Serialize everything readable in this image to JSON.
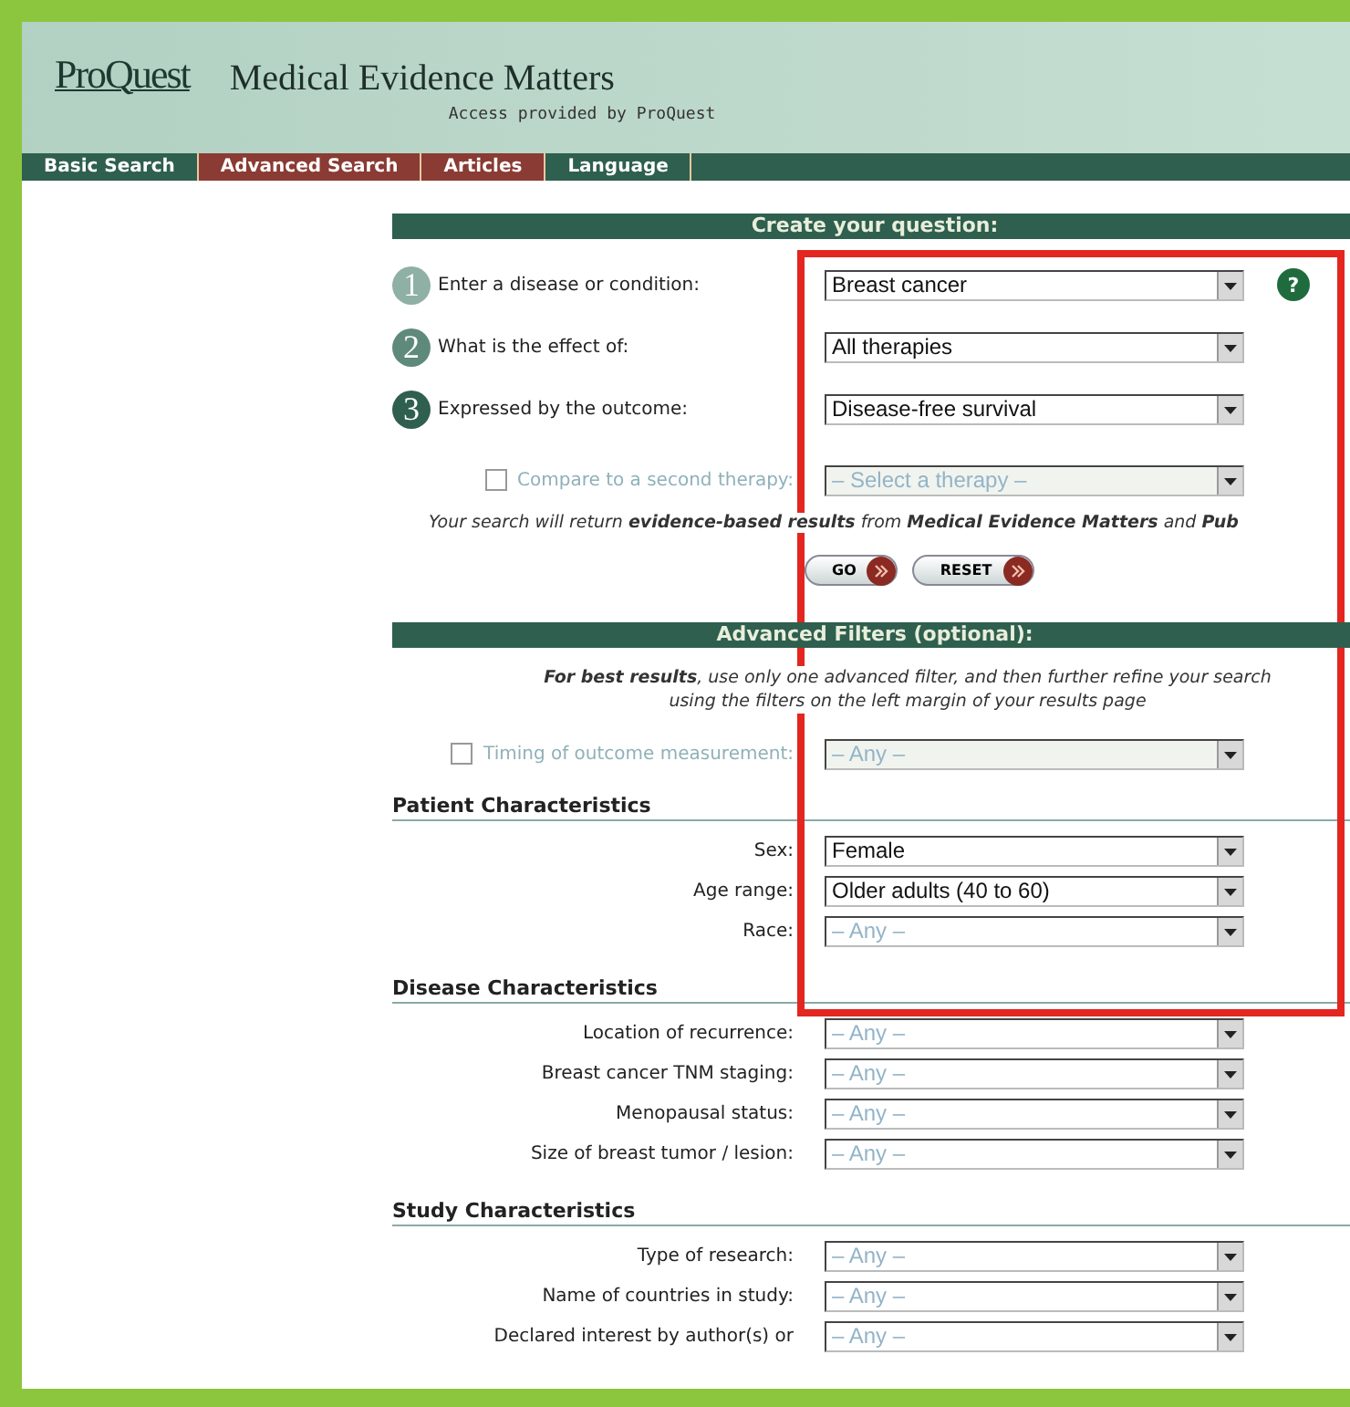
{
  "header": {
    "logo": "ProQuest",
    "title": "Medical Evidence Matters",
    "subtitle": "Access provided by ProQuest"
  },
  "nav": [
    {
      "label": "Basic Search",
      "color": "#2f5f4e"
    },
    {
      "label": "Advanced Search",
      "color": "#8a3b33"
    },
    {
      "label": "Articles",
      "color": "#8a3b33"
    },
    {
      "label": "Language",
      "color": "#2f5f4e"
    }
  ],
  "question": {
    "title": "Create your question:",
    "steps": [
      {
        "number": "1",
        "label": "Enter a disease or condition:",
        "value": "Breast cancer",
        "color": "#8fb0a4"
      },
      {
        "number": "2",
        "label": "What is the effect of:",
        "value": "All therapies",
        "color": "#5f8a7b"
      },
      {
        "number": "3",
        "label": "Expressed by the outcome:",
        "value": "Disease-free survival",
        "color": "#2f5f4e"
      }
    ],
    "help": "?",
    "compare": {
      "label": "Compare to a second therapy:",
      "checked": false,
      "disabled": true,
      "placeholder": "– Select a therapy –"
    },
    "note": "Your search will return **evidence-based results** from **Medical Evidence Matters** and **Pub**",
    "buttons": [
      "GO",
      "RESET"
    ]
  },
  "advanced": {
    "title": "Advanced Filters (optional):",
    "advice": [
      "**For best results**, use only one advanced filter, and then further refine your search",
      "using the filters on the left margin of your results page"
    ],
    "timing": {
      "label": "Timing of outcome measurement:",
      "checked": false,
      "disabled": true,
      "placeholder": "– Any –"
    },
    "groups": [
      {
        "title": "Patient Characteristics",
        "fields": [
          {
            "label": "Sex:",
            "value": "Female"
          },
          {
            "label": "Age range:",
            "value": "Older adults (40 to 60)"
          },
          {
            "label": "Race:",
            "placeholder": "– Any –"
          }
        ]
      },
      {
        "title": "Disease Characteristics",
        "fields": [
          {
            "label": "Location of recurrence:",
            "placeholder": "– Any –"
          },
          {
            "label": "Breast cancer TNM staging:",
            "placeholder": "– Any –"
          },
          {
            "label": "Menopausal status:",
            "placeholder": "– Any –"
          },
          {
            "label": "Size of breast tumor / lesion:",
            "placeholder": "– Any –"
          }
        ]
      },
      {
        "title": "Study Characteristics",
        "fields": [
          {
            "label": "Type of research:",
            "placeholder": "– Any –"
          },
          {
            "label": "Name of countries in study:",
            "placeholder": "– Any –"
          },
          {
            "label": "Declared interest by author(s) or",
            "placeholder": "– Any –"
          }
        ]
      }
    ]
  },
  "annotation_frame": true
}
